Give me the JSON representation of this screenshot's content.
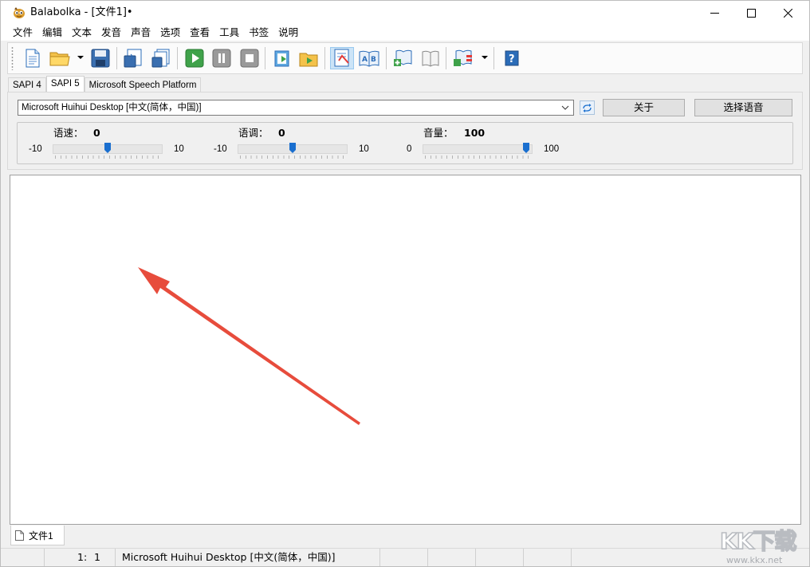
{
  "window": {
    "title": "Balabolka - [文件1]•"
  },
  "menu": [
    "文件",
    "编辑",
    "文本",
    "发音",
    "声音",
    "选项",
    "查看",
    "工具",
    "书签",
    "说明"
  ],
  "tabs": [
    "SAPI 4",
    "SAPI 5",
    "Microsoft Speech Platform"
  ],
  "voice": {
    "selected": "Microsoft Huihui Desktop [中文(简体，中国)]",
    "about_label": "关于",
    "choose_label": "选择语音"
  },
  "sliders": {
    "rate": {
      "label": "语速：",
      "value": "0",
      "min": "-10",
      "max": "10",
      "position": 0.5
    },
    "pitch": {
      "label": "语调：",
      "value": "0",
      "min": "-10",
      "max": "10",
      "position": 0.5
    },
    "volume": {
      "label": "音量：",
      "value": "100",
      "min": "0",
      "max": "100",
      "position": 1.0
    }
  },
  "documents": [
    {
      "name": "文件1"
    }
  ],
  "status": {
    "cursor_line": "1:",
    "cursor_col": "1",
    "voice": "Microsoft Huihui Desktop [中文(简体，中国)]"
  },
  "watermark": {
    "text": "KK下载",
    "url": "www.kkx.net"
  },
  "colors": {
    "accent_blue": "#1a6fcf",
    "arrow_red": "#e74c3c"
  }
}
